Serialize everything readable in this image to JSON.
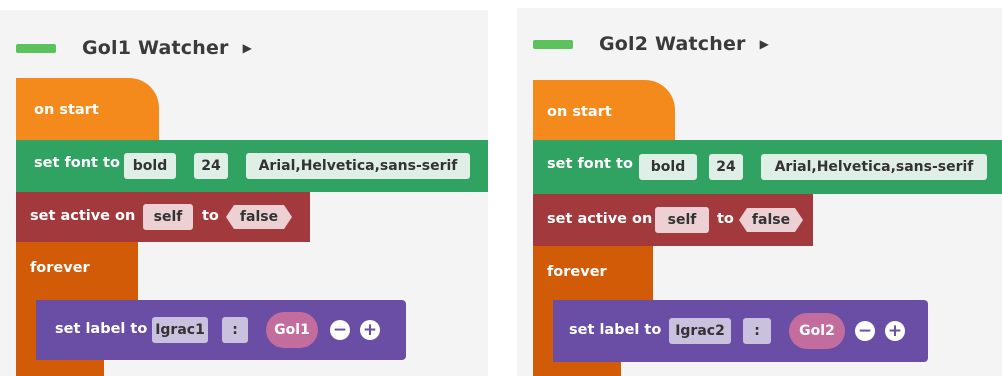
{
  "panels": [
    {
      "title": "Gol1 Watcher",
      "on_start": "on start",
      "set_font": {
        "label": "set font to",
        "weight": "bold",
        "size": "24",
        "family": "Arial,Helvetica,sans-serif"
      },
      "set_active": {
        "label": "set active on",
        "target": "self",
        "to": "to",
        "value": "false"
      },
      "forever": "forever",
      "set_label": {
        "label": "set label to",
        "text": "Igrac1",
        "sep": ":",
        "var": "Gol1"
      }
    },
    {
      "title": "Gol2 Watcher",
      "on_start": "on start",
      "set_font": {
        "label": "set font to",
        "weight": "bold",
        "size": "24",
        "family": "Arial,Helvetica,sans-serif"
      },
      "set_active": {
        "label": "set active on",
        "target": "self",
        "to": "to",
        "value": "false"
      },
      "forever": "forever",
      "set_label": {
        "label": "set label to",
        "text": "Igrac2",
        "sep": ":",
        "var": "Gol2"
      }
    }
  ],
  "icons": {
    "collapse": "triangle-right-icon",
    "remove": "minus-circle-icon",
    "add": "plus-circle-icon"
  },
  "colors": {
    "event": "#f58a1c",
    "looks": "#30a261",
    "active": "#a2393c",
    "loop": "#d25b07",
    "label": "#6a4ea6",
    "variable": "#c26d9d"
  }
}
